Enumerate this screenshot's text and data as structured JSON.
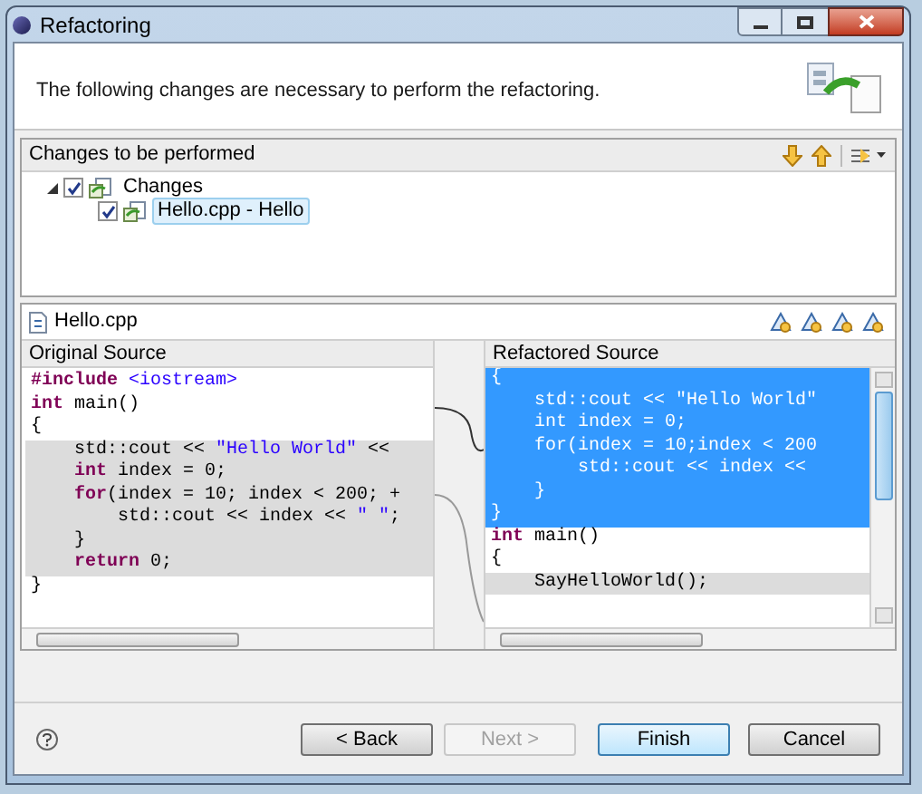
{
  "window": {
    "title": "Refactoring"
  },
  "header": {
    "message": "The following changes are necessary to perform the refactoring."
  },
  "changes_panel": {
    "title": "Changes to be performed",
    "tree": [
      {
        "label": "Changes",
        "checked": true,
        "expanded": true,
        "selected": false,
        "children": [
          {
            "label": "Hello.cpp - Hello",
            "checked": true,
            "selected": true
          }
        ]
      }
    ]
  },
  "compare": {
    "file": "Hello.cpp",
    "original": {
      "title": "Original Source",
      "lines": [
        {
          "changed": false,
          "segments": [
            {
              "text": "#include",
              "kind": "keyword"
            },
            {
              "text": " <iostream>",
              "kind": "string"
            }
          ]
        },
        {
          "changed": false,
          "segments": [
            {
              "text": "int",
              "kind": "keyword"
            },
            {
              "text": " main()",
              "kind": "plain"
            }
          ]
        },
        {
          "changed": false,
          "segments": [
            {
              "text": "{",
              "kind": "plain"
            }
          ]
        },
        {
          "changed": true,
          "segments": [
            {
              "text": "    std::cout << ",
              "kind": "plain"
            },
            {
              "text": "\"Hello World\"",
              "kind": "string"
            },
            {
              "text": " <<",
              "kind": "plain"
            }
          ]
        },
        {
          "changed": true,
          "segments": [
            {
              "text": "    int",
              "kind": "keyword"
            },
            {
              "text": " index = 0;",
              "kind": "plain"
            }
          ]
        },
        {
          "changed": true,
          "segments": [
            {
              "text": "    for",
              "kind": "keyword"
            },
            {
              "text": "(index = 10; index < 200; +",
              "kind": "plain"
            }
          ]
        },
        {
          "changed": true,
          "segments": [
            {
              "text": "        std::cout << index << ",
              "kind": "plain"
            },
            {
              "text": "\" \"",
              "kind": "string"
            },
            {
              "text": ";",
              "kind": "plain"
            }
          ]
        },
        {
          "changed": true,
          "segments": [
            {
              "text": "    }",
              "kind": "plain"
            }
          ]
        },
        {
          "changed": true,
          "segments": [
            {
              "text": "    return",
              "kind": "keyword"
            },
            {
              "text": " 0;",
              "kind": "plain"
            }
          ]
        },
        {
          "changed": false,
          "segments": [
            {
              "text": "}",
              "kind": "plain"
            }
          ]
        }
      ]
    },
    "refactored": {
      "title": "Refactored Source",
      "lines": [
        {
          "selected": true,
          "text": "{"
        },
        {
          "selected": true,
          "text": "    std::cout << \"Hello World\""
        },
        {
          "selected": true,
          "text": "    int index = 0;"
        },
        {
          "selected": true,
          "text": "    for(index = 10;index < 200"
        },
        {
          "selected": true,
          "text": "        std::cout << index <<"
        },
        {
          "selected": true,
          "text": "    }"
        },
        {
          "selected": true,
          "text": "}"
        },
        {
          "selected": false,
          "changed": false,
          "segments": [
            {
              "text": "int",
              "kind": "keyword"
            },
            {
              "text": " main()",
              "kind": "plain"
            }
          ]
        },
        {
          "selected": false,
          "changed": false,
          "segments": [
            {
              "text": "{",
              "kind": "plain"
            }
          ]
        },
        {
          "selected": false,
          "changed": true,
          "segments": [
            {
              "text": "    SayHelloWorld();",
              "kind": "plain"
            }
          ]
        }
      ]
    }
  },
  "buttons": [
    {
      "label": "< Back",
      "disabled": false,
      "default": false
    },
    {
      "label": "Next >",
      "disabled": true,
      "default": false
    },
    {
      "label": "Finish",
      "disabled": false,
      "default": true
    },
    {
      "label": "Cancel",
      "disabled": false,
      "default": false
    }
  ]
}
